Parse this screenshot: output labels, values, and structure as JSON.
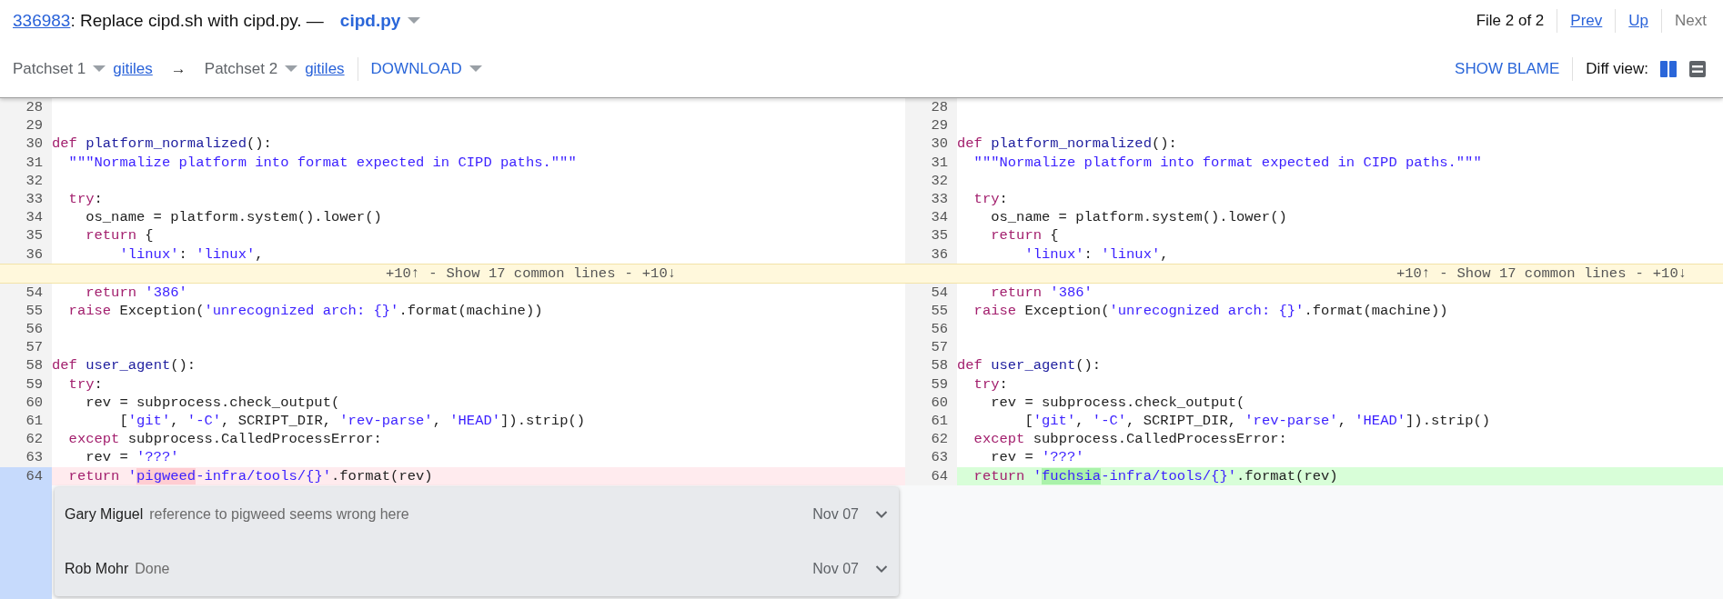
{
  "header": {
    "change_number": "336983",
    "subject": ": Replace cipd.sh with cipd.py. —",
    "file_name": "cipd.py",
    "position": "File 2 of 2",
    "nav_links": [
      {
        "label": "Prev",
        "disabled": false
      },
      {
        "label": "Up",
        "disabled": false
      },
      {
        "label": "Next",
        "disabled": true
      }
    ]
  },
  "toolbar": {
    "base_patchset": "Patchset 1",
    "base_link": "gitiles",
    "arrow": "→",
    "revision_patchset": "Patchset 2",
    "revision_link": "gitiles",
    "download": "DOWNLOAD",
    "blame_button": "SHOW BLAME",
    "diff_view_label": "Diff view:",
    "diff_modes": [
      {
        "kind": "side-by-side",
        "selected": true
      },
      {
        "kind": "unified",
        "selected": false
      }
    ]
  },
  "panes": [
    {
      "kind": "base",
      "rows": [
        {
          "kind": "line",
          "number": "28"
        },
        {
          "kind": "line",
          "number": "29"
        },
        {
          "kind": "line",
          "number": "30",
          "tokens": [
            {
              "kind": "kw",
              "text": "def "
            },
            {
              "kind": "fn",
              "text": "platform_normalized"
            },
            {
              "kind": "plain",
              "text": "():"
            }
          ]
        },
        {
          "kind": "line",
          "number": "31",
          "tokens": [
            {
              "kind": "str",
              "text": "  \"\"\"Normalize platform into format expected in CIPD paths.\"\"\""
            }
          ]
        },
        {
          "kind": "line",
          "number": "32"
        },
        {
          "kind": "line",
          "number": "33",
          "tokens": [
            {
              "kind": "kw",
              "text": "  try"
            },
            {
              "kind": "plain",
              "text": ":"
            }
          ]
        },
        {
          "kind": "line",
          "number": "34",
          "tokens": [
            {
              "kind": "plain",
              "text": "    os_name = platform.system().lower()"
            }
          ]
        },
        {
          "kind": "line",
          "number": "35",
          "tokens": [
            {
              "kind": "kw",
              "text": "    return"
            },
            {
              "kind": "plain",
              "text": " {"
            }
          ]
        },
        {
          "kind": "line",
          "number": "36",
          "tokens": [
            {
              "kind": "str",
              "text": "        'linux'"
            },
            {
              "kind": "plain",
              "text": ": "
            },
            {
              "kind": "str",
              "text": "'linux'"
            },
            {
              "kind": "plain",
              "text": ","
            }
          ]
        },
        {
          "kind": "context",
          "above": "+10↑",
          "separator_1": "-",
          "label": "Show 17 common lines",
          "separator_2": "-",
          "below": "+10↓"
        },
        {
          "kind": "line",
          "number": "54",
          "tokens": [
            {
              "kind": "kw",
              "text": "    return "
            },
            {
              "kind": "str",
              "text": "'386'"
            }
          ]
        },
        {
          "kind": "line",
          "number": "55",
          "tokens": [
            {
              "kind": "kw",
              "text": "  raise"
            },
            {
              "kind": "plain",
              "text": " Exception("
            },
            {
              "kind": "str",
              "text": "'unrecognized arch: {}'"
            },
            {
              "kind": "plain",
              "text": ".format(machine))"
            }
          ]
        },
        {
          "kind": "line",
          "number": "56"
        },
        {
          "kind": "line",
          "number": "57"
        },
        {
          "kind": "line",
          "number": "58",
          "tokens": [
            {
              "kind": "kw",
              "text": "def "
            },
            {
              "kind": "fn",
              "text": "user_agent"
            },
            {
              "kind": "plain",
              "text": "():"
            }
          ]
        },
        {
          "kind": "line",
          "number": "59",
          "tokens": [
            {
              "kind": "kw",
              "text": "  try"
            },
            {
              "kind": "plain",
              "text": ":"
            }
          ]
        },
        {
          "kind": "line",
          "number": "60",
          "tokens": [
            {
              "kind": "plain",
              "text": "    rev = subprocess.check_output("
            }
          ]
        },
        {
          "kind": "line",
          "number": "61",
          "tokens": [
            {
              "kind": "plain",
              "text": "        ["
            },
            {
              "kind": "str",
              "text": "'git'"
            },
            {
              "kind": "plain",
              "text": ", "
            },
            {
              "kind": "str",
              "text": "'-C'"
            },
            {
              "kind": "plain",
              "text": ", SCRIPT_DIR, "
            },
            {
              "kind": "str",
              "text": "'rev-parse'"
            },
            {
              "kind": "plain",
              "text": ", "
            },
            {
              "kind": "str",
              "text": "'HEAD'"
            },
            {
              "kind": "plain",
              "text": "]).strip()"
            }
          ]
        },
        {
          "kind": "line",
          "number": "62",
          "tokens": [
            {
              "kind": "kw",
              "text": "  except"
            },
            {
              "kind": "plain",
              "text": " subprocess.CalledProcessError:"
            }
          ]
        },
        {
          "kind": "line",
          "number": "63",
          "tokens": [
            {
              "kind": "plain",
              "text": "    rev = "
            },
            {
              "kind": "str",
              "text": "'???'"
            }
          ]
        },
        {
          "kind": "removed",
          "number": "64",
          "tokens": [
            {
              "kind": "kw",
              "text": "  return "
            },
            {
              "kind": "str",
              "text": "'"
            },
            {
              "kind": "mark",
              "text": "pigweed"
            },
            {
              "kind": "str",
              "text": "-infra/tools/{}'"
            },
            {
              "kind": "plain",
              "text": ".format(rev)"
            }
          ]
        }
      ],
      "comments": [
        {
          "author": "Gary Miguel",
          "message": "reference to pigweed seems wrong here",
          "date": "Nov 07"
        },
        {
          "author": "Rob Mohr",
          "message": "Done",
          "date": "Nov 07"
        }
      ]
    },
    {
      "kind": "revision",
      "rows": [
        {
          "kind": "line",
          "number": "28"
        },
        {
          "kind": "line",
          "number": "29"
        },
        {
          "kind": "line",
          "number": "30",
          "tokens": [
            {
              "kind": "kw",
              "text": "def "
            },
            {
              "kind": "fn",
              "text": "platform_normalized"
            },
            {
              "kind": "plain",
              "text": "():"
            }
          ]
        },
        {
          "kind": "line",
          "number": "31",
          "tokens": [
            {
              "kind": "str",
              "text": "  \"\"\"Normalize platform into format expected in CIPD paths.\"\"\""
            }
          ]
        },
        {
          "kind": "line",
          "number": "32"
        },
        {
          "kind": "line",
          "number": "33",
          "tokens": [
            {
              "kind": "kw",
              "text": "  try"
            },
            {
              "kind": "plain",
              "text": ":"
            }
          ]
        },
        {
          "kind": "line",
          "number": "34",
          "tokens": [
            {
              "kind": "plain",
              "text": "    os_name = platform.system().lower()"
            }
          ]
        },
        {
          "kind": "line",
          "number": "35",
          "tokens": [
            {
              "kind": "kw",
              "text": "    return"
            },
            {
              "kind": "plain",
              "text": " {"
            }
          ]
        },
        {
          "kind": "line",
          "number": "36",
          "tokens": [
            {
              "kind": "str",
              "text": "        'linux'"
            },
            {
              "kind": "plain",
              "text": ": "
            },
            {
              "kind": "str",
              "text": "'linux'"
            },
            {
              "kind": "plain",
              "text": ","
            }
          ]
        },
        {
          "kind": "context",
          "above": "+10↑",
          "separator_1": "-",
          "label": "Show 17 common lines",
          "separator_2": "-",
          "below": "+10↓"
        },
        {
          "kind": "line",
          "number": "54",
          "tokens": [
            {
              "kind": "kw",
              "text": "    return "
            },
            {
              "kind": "str",
              "text": "'386'"
            }
          ]
        },
        {
          "kind": "line",
          "number": "55",
          "tokens": [
            {
              "kind": "kw",
              "text": "  raise"
            },
            {
              "kind": "plain",
              "text": " Exception("
            },
            {
              "kind": "str",
              "text": "'unrecognized arch: {}'"
            },
            {
              "kind": "plain",
              "text": ".format(machine))"
            }
          ]
        },
        {
          "kind": "line",
          "number": "56"
        },
        {
          "kind": "line",
          "number": "57"
        },
        {
          "kind": "line",
          "number": "58",
          "tokens": [
            {
              "kind": "kw",
              "text": "def "
            },
            {
              "kind": "fn",
              "text": "user_agent"
            },
            {
              "kind": "plain",
              "text": "():"
            }
          ]
        },
        {
          "kind": "line",
          "number": "59",
          "tokens": [
            {
              "kind": "kw",
              "text": "  try"
            },
            {
              "kind": "plain",
              "text": ":"
            }
          ]
        },
        {
          "kind": "line",
          "number": "60",
          "tokens": [
            {
              "kind": "plain",
              "text": "    rev = subprocess.check_output("
            }
          ]
        },
        {
          "kind": "line",
          "number": "61",
          "tokens": [
            {
              "kind": "plain",
              "text": "        ["
            },
            {
              "kind": "str",
              "text": "'git'"
            },
            {
              "kind": "plain",
              "text": ", "
            },
            {
              "kind": "str",
              "text": "'-C'"
            },
            {
              "kind": "plain",
              "text": ", SCRIPT_DIR, "
            },
            {
              "kind": "str",
              "text": "'rev-parse'"
            },
            {
              "kind": "plain",
              "text": ", "
            },
            {
              "kind": "str",
              "text": "'HEAD'"
            },
            {
              "kind": "plain",
              "text": "]).strip()"
            }
          ]
        },
        {
          "kind": "line",
          "number": "62",
          "tokens": [
            {
              "kind": "kw",
              "text": "  except"
            },
            {
              "kind": "plain",
              "text": " subprocess.CalledProcessError:"
            }
          ]
        },
        {
          "kind": "line",
          "number": "63",
          "tokens": [
            {
              "kind": "plain",
              "text": "    rev = "
            },
            {
              "kind": "str",
              "text": "'???'"
            }
          ]
        },
        {
          "kind": "added",
          "number": "64",
          "tokens": [
            {
              "kind": "kw",
              "text": "  return "
            },
            {
              "kind": "str",
              "text": "'"
            },
            {
              "kind": "mark",
              "text": "fuchsia"
            },
            {
              "kind": "str",
              "text": "-infra/tools/{}'"
            },
            {
              "kind": "plain",
              "text": ".format(rev)"
            }
          ]
        }
      ]
    }
  ]
}
